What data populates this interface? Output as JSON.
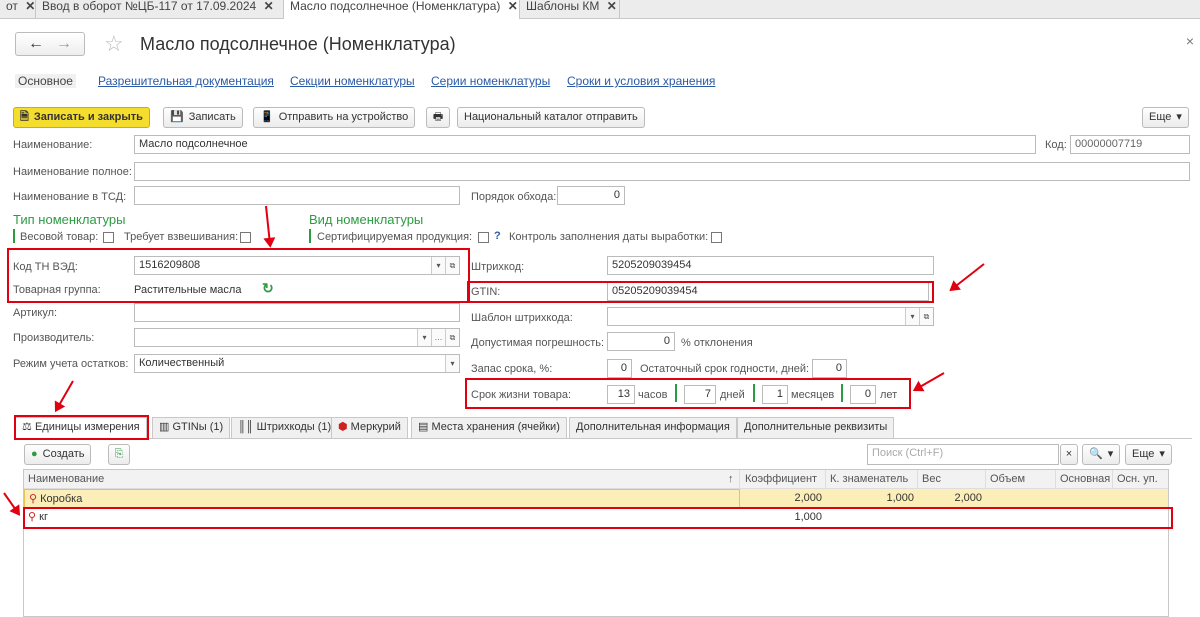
{
  "window_tabs": [
    {
      "label": "от"
    },
    {
      "label": "Ввод в оборот №ЦБ-117 от 17.09.2024"
    },
    {
      "label": "Масло подсолнечное (Номенклатура)"
    },
    {
      "label": "Шаблоны КМ"
    }
  ],
  "header": {
    "title": "Масло подсолнечное (Номенклатура)",
    "back": "←",
    "forward": "→",
    "close": "×"
  },
  "sections": [
    "Основное",
    "Разрешительная документация",
    "Секции номенклатуры",
    "Серии номенклатуры",
    "Сроки и условия хранения"
  ],
  "toolbar": {
    "save_close": "Записать и закрыть",
    "save": "Записать",
    "send_device": "Отправить на устройство",
    "national_catalog": "Национальный каталог отправить",
    "more": "Еще"
  },
  "form": {
    "name_label": "Наименование:",
    "name_value": "Масло подсолнечное",
    "code_label": "Код:",
    "code_value": "00000007719",
    "fullname_label": "Наименование полное:",
    "tsd_label": "Наименование в ТСД:",
    "order_label": "Порядок обхода:",
    "order_value": "0",
    "type_header": "Тип номенклатуры",
    "weight_label": "Весовой товар:",
    "requires_weighing_label": "Требует взвешивания:",
    "kind_header": "Вид номенклатуры",
    "certified_label": "Сертифицируемая продукция:",
    "help": "?",
    "date_control_label": "Контроль заполнения даты выработки:",
    "tnved_label": "Код ТН ВЭД:",
    "tnved_value": "1516209808",
    "group_label": "Товарная группа:",
    "group_value": "Растительные масла",
    "article_label": "Артикул:",
    "producer_label": "Производитель:",
    "stock_mode_label": "Режим учета остатков:",
    "stock_mode_value": "Количественный",
    "barcode_label": "Штрихкод:",
    "barcode_value": "5205209039454",
    "gtin_label": "GTIN:",
    "gtin_value": "05205209039454",
    "barcode_template_label": "Шаблон штрихкода:",
    "tolerance_label": "Допустимая погрешность:",
    "tolerance_value": "0",
    "tolerance_unit": "% отклонения",
    "reserve_label": "Запас срока, %:",
    "reserve_value": "0",
    "residual_label": "Остаточный срок годности, дней:",
    "residual_value": "0",
    "shelf_label": "Срок жизни товара:",
    "hours_value": "13",
    "hours_unit": "часов",
    "days_value": "7",
    "days_unit": "дней",
    "months_value": "1",
    "months_unit": "месяцев",
    "years_value": "0",
    "years_unit": "лет"
  },
  "tabs": [
    "Единицы измерения",
    "GTINы (1)",
    "Штрихкоды (1)",
    "Меркурий",
    "Места хранения (ячейки)",
    "Дополнительная информация",
    "Дополнительные реквизиты"
  ],
  "table_toolbar": {
    "create": "Создать",
    "search_placeholder": "Поиск (Ctrl+F)",
    "more": "Еще"
  },
  "table": {
    "columns": [
      "Наименование",
      "↑",
      "Коэффициент",
      "К. знаменатель",
      "Вес",
      "Объем",
      "Основная",
      "Осн. уп."
    ],
    "rows": [
      {
        "name": "Коробка",
        "coef": "2,000",
        "denom": "1,000",
        "weight": "2,000"
      },
      {
        "name": "кг",
        "coef": "1,000",
        "denom": "",
        "weight": ""
      }
    ]
  },
  "colors": {
    "accent_green": "#2c9c42",
    "highlight_red": "#e0000f",
    "yellow_button": "#f5dd2e",
    "link": "#2b5aa6",
    "selected_row": "#fbeeb8"
  }
}
